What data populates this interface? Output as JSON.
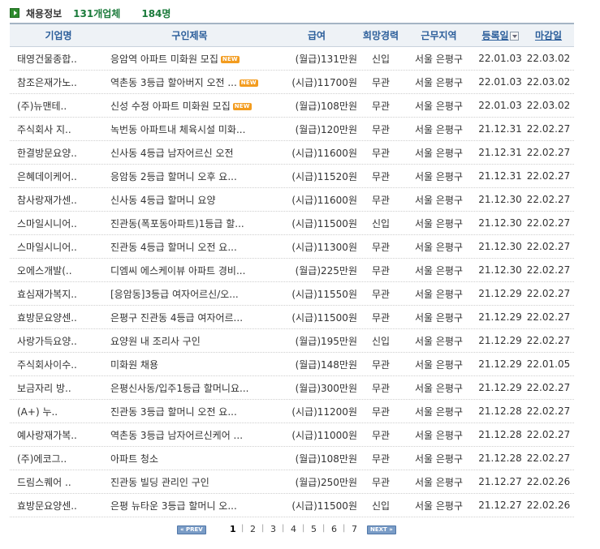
{
  "header": {
    "title": "채용정보",
    "company_count": "131개업체",
    "job_count": "184명"
  },
  "columns": [
    "기업명",
    "구인제목",
    "급여",
    "희망경력",
    "근무지역",
    "등록일",
    "마감일"
  ],
  "rows": [
    {
      "company": "태영건물종합..",
      "title": "응암역 아파트 미화원 모집",
      "is_new": true,
      "salary": "(월급)131만원",
      "career": "신입",
      "region": "서울 은평구",
      "reg_date": "22.01.03",
      "deadline": "22.03.02"
    },
    {
      "company": "참조은재가노..",
      "title": "역촌동 3등급 할아버지 오전 ...",
      "is_new": true,
      "salary": "(시급)11700원",
      "career": "무관",
      "region": "서울 은평구",
      "reg_date": "22.01.03",
      "deadline": "22.03.02"
    },
    {
      "company": "(주)뉴맨테..",
      "title": "신성 수정 아파트 미화원 모집",
      "is_new": true,
      "salary": "(월급)108만원",
      "career": "무관",
      "region": "서울 은평구",
      "reg_date": "22.01.03",
      "deadline": "22.03.02"
    },
    {
      "company": "주식회사 지..",
      "title": "녹번동 아파트내 체육시설 미화...",
      "is_new": false,
      "salary": "(월급)120만원",
      "career": "무관",
      "region": "서울 은평구",
      "reg_date": "21.12.31",
      "deadline": "22.02.27"
    },
    {
      "company": "한결방문요양..",
      "title": "신사동 4등급 남자어르신 오전",
      "is_new": false,
      "salary": "(시급)11600원",
      "career": "무관",
      "region": "서울 은평구",
      "reg_date": "21.12.31",
      "deadline": "22.02.27"
    },
    {
      "company": "은혜데이케어..",
      "title": "응암동 2등급 할머니 오후 요...",
      "is_new": false,
      "salary": "(시급)11520원",
      "career": "무관",
      "region": "서울 은평구",
      "reg_date": "21.12.31",
      "deadline": "22.02.27"
    },
    {
      "company": "참사랑재가센..",
      "title": "신사동 4등급 할머니 요양",
      "is_new": false,
      "salary": "(시급)11600원",
      "career": "무관",
      "region": "서울 은평구",
      "reg_date": "21.12.30",
      "deadline": "22.02.27"
    },
    {
      "company": "스마일시니어..",
      "title": "진관동(폭포동아파트)1등급 할...",
      "is_new": false,
      "salary": "(시급)11500원",
      "career": "신입",
      "region": "서울 은평구",
      "reg_date": "21.12.30",
      "deadline": "22.02.27"
    },
    {
      "company": "스마일시니어..",
      "title": "진관동 4등급 할머니 오전 요...",
      "is_new": false,
      "salary": "(시급)11300원",
      "career": "무관",
      "region": "서울 은평구",
      "reg_date": "21.12.30",
      "deadline": "22.02.27"
    },
    {
      "company": "오에스개발(..",
      "title": "디엠씨 에스케이뷰 아파트 경비...",
      "is_new": false,
      "salary": "(월급)225만원",
      "career": "무관",
      "region": "서울 은평구",
      "reg_date": "21.12.30",
      "deadline": "22.02.27"
    },
    {
      "company": "효심재가복지..",
      "title": "[응암동]3등급 여자어르신/오...",
      "is_new": false,
      "salary": "(시급)11550원",
      "career": "무관",
      "region": "서울 은평구",
      "reg_date": "21.12.29",
      "deadline": "22.02.27"
    },
    {
      "company": "효방문요양센..",
      "title": "은평구 진관동 4등급 여자어르...",
      "is_new": false,
      "salary": "(시급)11500원",
      "career": "무관",
      "region": "서울 은평구",
      "reg_date": "21.12.29",
      "deadline": "22.02.27"
    },
    {
      "company": "사랑가득요양..",
      "title": "요양원 내 조리사 구인",
      "is_new": false,
      "salary": "(월급)195만원",
      "career": "신입",
      "region": "서울 은평구",
      "reg_date": "21.12.29",
      "deadline": "22.02.27"
    },
    {
      "company": "주식회사이수..",
      "title": "미화원 채용",
      "is_new": false,
      "salary": "(월급)148만원",
      "career": "무관",
      "region": "서울 은평구",
      "reg_date": "21.12.29",
      "deadline": "22.01.05"
    },
    {
      "company": "보금자리 방..",
      "title": "은평신사동/입주1등급 할머니요...",
      "is_new": false,
      "salary": "(월급)300만원",
      "career": "무관",
      "region": "서울 은평구",
      "reg_date": "21.12.29",
      "deadline": "22.02.27"
    },
    {
      "company": "(A+) 누..",
      "title": "진관동 3등급 할머니 오전 요...",
      "is_new": false,
      "salary": "(시급)11200원",
      "career": "무관",
      "region": "서울 은평구",
      "reg_date": "21.12.28",
      "deadline": "22.02.27"
    },
    {
      "company": "예사랑재가복..",
      "title": "역촌동 3등급 남자어르신케어 ...",
      "is_new": false,
      "salary": "(시급)11000원",
      "career": "무관",
      "region": "서울 은평구",
      "reg_date": "21.12.28",
      "deadline": "22.02.27"
    },
    {
      "company": "(주)에코그..",
      "title": "아파트 청소",
      "is_new": false,
      "salary": "(월급)108만원",
      "career": "무관",
      "region": "서울 은평구",
      "reg_date": "21.12.28",
      "deadline": "22.02.27"
    },
    {
      "company": "드림스퀘어 ..",
      "title": "진관동 빌딩 관리인 구인",
      "is_new": false,
      "salary": "(월급)250만원",
      "career": "무관",
      "region": "서울 은평구",
      "reg_date": "21.12.27",
      "deadline": "22.02.26"
    },
    {
      "company": "효방문요양센..",
      "title": "은평 뉴타운 3등급 할머니 오...",
      "is_new": false,
      "salary": "(시급)11500원",
      "career": "신입",
      "region": "서울 은평구",
      "reg_date": "21.12.27",
      "deadline": "22.02.26"
    }
  ],
  "new_badge_label": "NEW",
  "pagination": {
    "prev_label": "PREV",
    "next_label": "NEXT",
    "pages": [
      "1",
      "2",
      "3",
      "4",
      "5",
      "6",
      "7"
    ],
    "current": "1"
  },
  "colors": {
    "header_count": "#1a7a3a",
    "column_header": "#2a5d9a",
    "new_badge": "#f39c1f",
    "pager_button": "#7a9cc6"
  }
}
